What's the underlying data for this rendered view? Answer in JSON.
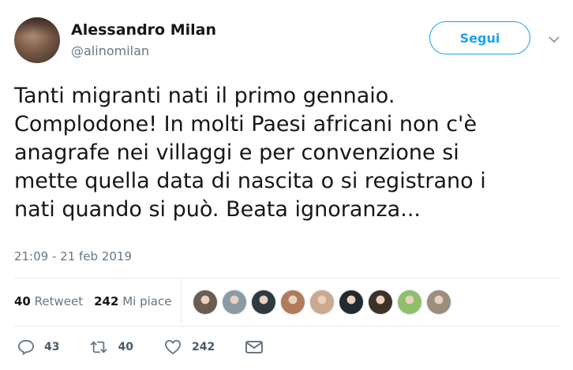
{
  "user": {
    "name": "Alessandro Milan",
    "handle": "@alinomilan"
  },
  "follow_button": {
    "label": "Segui"
  },
  "tweet": {
    "text": "Tanti migranti nati il primo gennaio.\nComplodone! In molti Paesi africani non c'è\nanagrafe nei villaggi e per convenzione si\nmette quella data di nascita o si registrano i\nnati quando si può. Beata ignoranza...",
    "timestamp": "21:09 - 21 feb 2019"
  },
  "stats": {
    "retweets_count": "40",
    "retweets_label": "Retweet",
    "likes_count": "242",
    "likes_label": "Mi piace"
  },
  "likers": [
    {
      "color": "#6b5d52"
    },
    {
      "color": "#8b9aa3"
    },
    {
      "color": "#2f3940"
    },
    {
      "color": "#b27a5c"
    },
    {
      "color": "#c9a98f"
    },
    {
      "color": "#222a30"
    },
    {
      "color": "#3c3226"
    },
    {
      "color": "#8fbf6a"
    },
    {
      "color": "#9c8d7d"
    }
  ],
  "actions": {
    "replies": "43",
    "retweets": "40",
    "likes": "242"
  },
  "colors": {
    "accent": "#1da1f2",
    "muted": "#657786",
    "text": "#14171a"
  }
}
